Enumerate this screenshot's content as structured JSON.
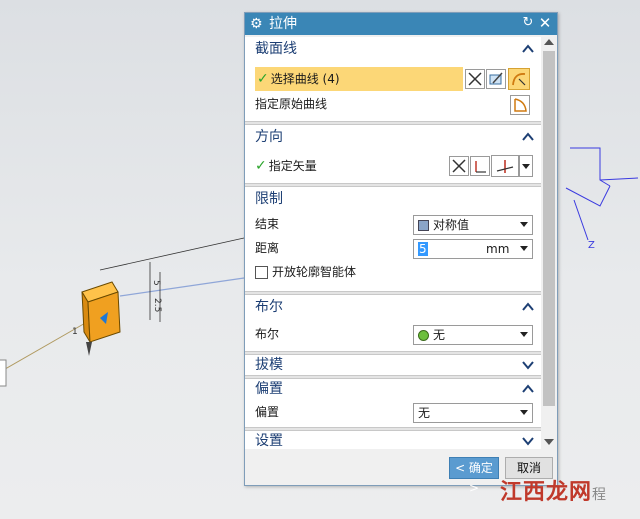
{
  "dialog": {
    "title": "拉伸",
    "icons": {
      "settings": "gear-icon",
      "reset": "reset-icon",
      "close": "close-icon"
    }
  },
  "sections": {
    "section_curve": {
      "title": "截面线",
      "select_curve": "选择曲线 (4)",
      "specify_original": "指定原始曲线"
    },
    "direction": {
      "title": "方向",
      "specify_vector": "指定矢量"
    },
    "limits": {
      "title": "限制",
      "end_label": "结束",
      "end_value": "对称值",
      "distance_label": "距离",
      "distance_value": "5",
      "distance_unit": "mm",
      "open_profile": "开放轮廓智能体"
    },
    "boolean": {
      "title": "布尔",
      "boolean_label": "布尔",
      "boolean_value": "无"
    },
    "draft": {
      "title": "拔模"
    },
    "offset": {
      "title": "偏置",
      "offset_label": "偏置",
      "offset_value": "无"
    },
    "settings": {
      "title": "设置"
    }
  },
  "buttons": {
    "ok": "< 确定 >",
    "cancel": "取消"
  },
  "watermark": {
    "main": "江西龙网",
    "suffix": "程"
  },
  "model_labels": {
    "dim1": "5",
    "dim2": "2.5",
    "axis_z": "Z",
    "dim3": "1"
  },
  "colors": {
    "titlebar": "#3a86b6",
    "highlight": "#fcd777",
    "section_title": "#1d3f74",
    "part": "#f0a020"
  }
}
